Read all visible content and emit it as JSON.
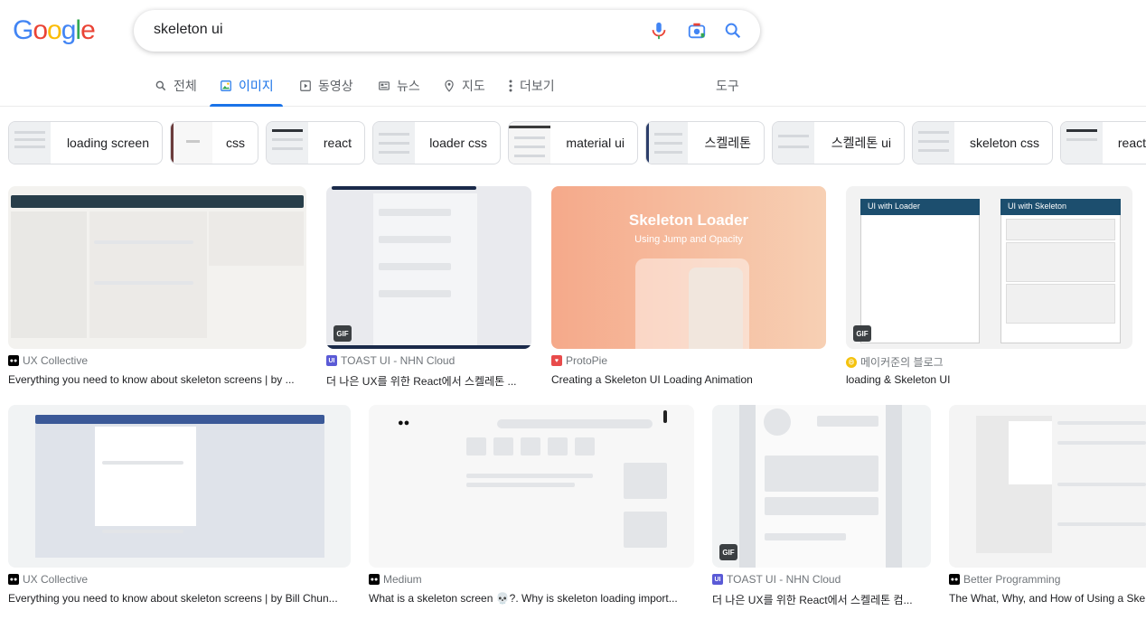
{
  "search": {
    "query": "skeleton ui"
  },
  "logo": [
    "G",
    "o",
    "o",
    "g",
    "l",
    "e"
  ],
  "tabs": [
    {
      "label": "전체"
    },
    {
      "label": "이미지"
    },
    {
      "label": "동영상"
    },
    {
      "label": "뉴스"
    },
    {
      "label": "지도"
    },
    {
      "label": "더보기"
    },
    {
      "label": "도구"
    }
  ],
  "chips": [
    {
      "label": "loading screen"
    },
    {
      "label": "css"
    },
    {
      "label": "react"
    },
    {
      "label": "loader css"
    },
    {
      "label": "material ui"
    },
    {
      "label": "스켈레톤"
    },
    {
      "label": "스켈레톤 ui"
    },
    {
      "label": "skeleton css"
    },
    {
      "label": "react"
    }
  ],
  "results": [
    {
      "source": "UX Collective",
      "title": "Everything you need to know about skeleton screens | by ..."
    },
    {
      "source": "TOAST UI - NHN Cloud",
      "title": "더 나은 UX를 위한 React에서 스켈레톤 ...",
      "badge": "GIF"
    },
    {
      "source": "ProtoPie",
      "title": "Creating a Skeleton UI Loading Animation",
      "image_heading": "Skeleton Loader",
      "image_sub": "Using Jump and Opacity"
    },
    {
      "source": "메이커준의 블로그",
      "title": "loading & Skeleton UI",
      "badge": "GIF",
      "image_left": "UI with Loader",
      "image_right": "UI with Skeleton"
    },
    {
      "source": "UX Collective",
      "title": "Everything you need to know about skeleton screens | by Bill Chun..."
    },
    {
      "source": "Medium",
      "title": "What is a skeleton screen 💀?. Why is skeleton loading import..."
    },
    {
      "source": "TOAST UI - NHN Cloud",
      "title": "더 나은 UX를 위한 React에서 스켈레톤 컴...",
      "badge": "GIF"
    },
    {
      "source": "Better Programming",
      "title": "The What, Why, and How of Using a Ske"
    }
  ],
  "colors": {
    "accent": "#1a73e8",
    "chip_border": "#dadce0"
  }
}
